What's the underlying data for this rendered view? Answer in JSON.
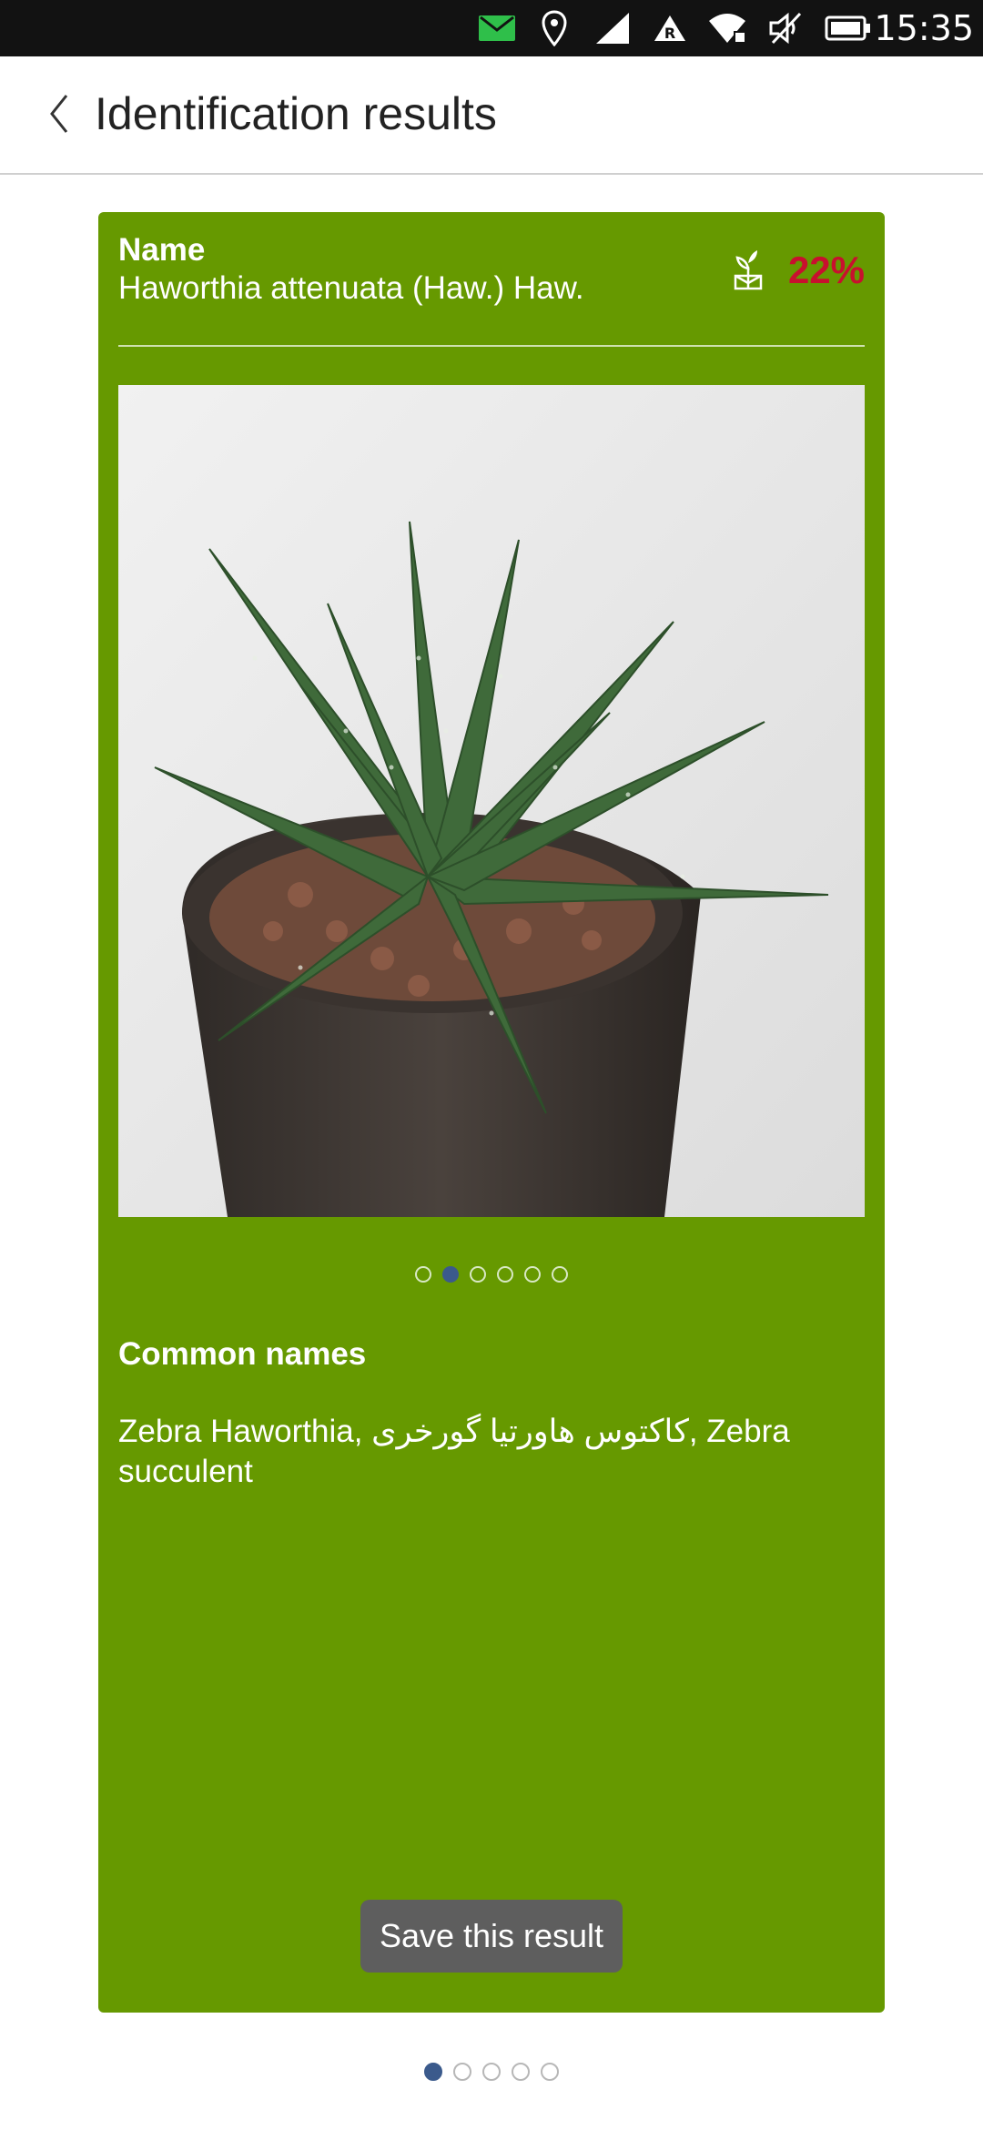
{
  "status_bar": {
    "time": "15:35",
    "icons": [
      "mail-icon",
      "location-icon",
      "signal-icon",
      "roaming-icon",
      "wifi-icon",
      "mute-icon",
      "battery-icon"
    ],
    "mail_color": "#2fbf4a"
  },
  "header": {
    "title": "Identification results"
  },
  "result": {
    "name_label": "Name",
    "name_value": "Haworthia attenuata (Haw.) Haw.",
    "score": "22%",
    "score_color": "#c8102e",
    "common_names_label": "Common names",
    "common_names_value": "Zebra Haworthia, کاکتوس هاورتیا گورخری, Zebra succulent",
    "save_button": "Save this result",
    "image_dots": 6,
    "image_dots_active": 2
  },
  "results_pager": {
    "count": 5,
    "active": 1
  },
  "colors": {
    "card": "#669900",
    "active_dot": "#3b5a8c"
  }
}
